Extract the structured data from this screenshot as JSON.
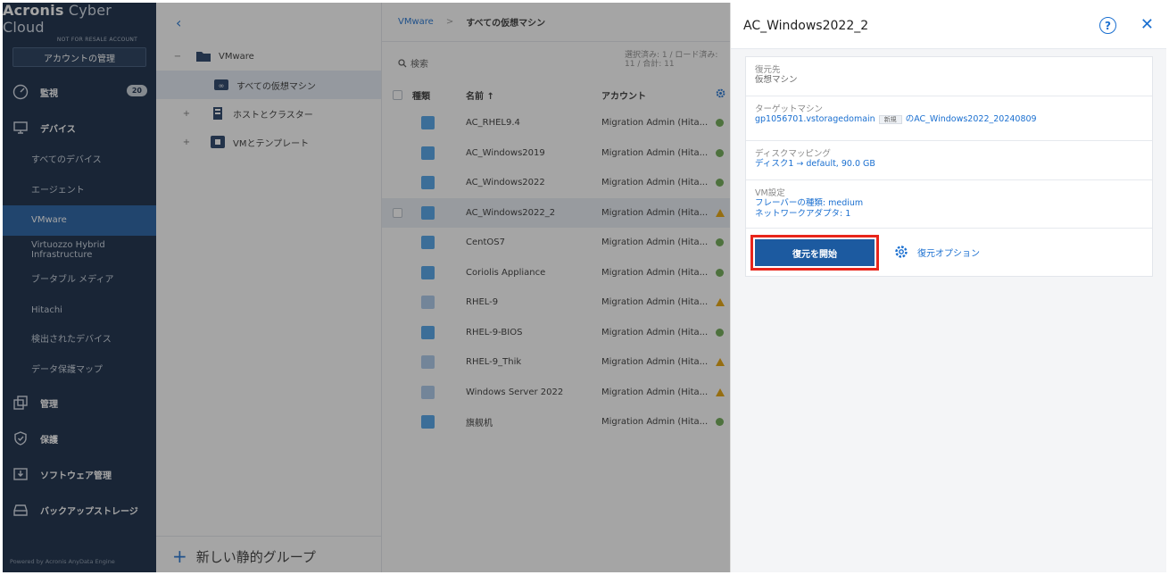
{
  "sidebar": {
    "brand_bold": "Acronis",
    "brand_light": " Cyber Cloud",
    "brand_tag": "NOT FOR RESALE ACCOUNT",
    "manage_button": "アカウントの管理",
    "monitor": "監視",
    "monitor_badge": "20",
    "devices": "デバイス",
    "sub_items": [
      "すべてのデバイス",
      "エージェント",
      "VMware",
      "Virtuozzo Hybrid Infrastructure",
      "ブータブル メディア",
      "Hitachi",
      "検出されたデバイス",
      "データ保護マップ"
    ],
    "admin": "管理",
    "protection": "保護",
    "software": "ソフトウェア管理",
    "backup_storage": "バックアップストレージ",
    "powered": "Powered by Acronis AnyData Engine"
  },
  "tree": {
    "back": "‹",
    "root": "VMware",
    "all_vms": "すべての仮想マシン",
    "hosts": "ホストとクラスター",
    "templates": "VMとテンプレート",
    "new_group": "新しい静的グループ"
  },
  "main": {
    "breadcrumb_1": "VMware",
    "breadcrumb_sep": ">",
    "breadcrumb_2": "すべての仮想マシン",
    "search": "検索",
    "selection_info": "選択済み: 1 / ロード済み: 11 / 合計: 11",
    "col_type": "種類",
    "col_name": "名前 ↑",
    "col_account": "アカウント",
    "rows": [
      {
        "name": "AC_RHEL9.4",
        "account": "Migration Admin (Hita...",
        "status": "ok",
        "on": true
      },
      {
        "name": "AC_Windows2019",
        "account": "Migration Admin (Hita...",
        "status": "ok",
        "on": true
      },
      {
        "name": "AC_Windows2022",
        "account": "Migration Admin (Hita...",
        "status": "ok",
        "on": true
      },
      {
        "name": "AC_Windows2022_2",
        "account": "Migration Admin (Hita...",
        "status": "warn",
        "on": true
      },
      {
        "name": "CentOS7",
        "account": "Migration Admin (Hita...",
        "status": "ok",
        "on": true
      },
      {
        "name": "Coriolis Appliance",
        "account": "Migration Admin (Hita...",
        "status": "ok",
        "on": true
      },
      {
        "name": "RHEL-9",
        "account": "Migration Admin (Hita...",
        "status": "warn",
        "on": false
      },
      {
        "name": "RHEL-9-BIOS",
        "account": "Migration Admin (Hita...",
        "status": "ok",
        "on": true
      },
      {
        "name": "RHEL-9_Thik",
        "account": "Migration Admin (Hita...",
        "status": "warn",
        "on": false
      },
      {
        "name": "Windows Server 2022",
        "account": "Migration Admin (Hita...",
        "status": "warn",
        "on": false
      },
      {
        "name": "旗舰机",
        "account": "Migration Admin (Hita...",
        "status": "ok",
        "on": true
      }
    ]
  },
  "panel": {
    "title": "AC_Windows2022_2",
    "help": "?",
    "close": "✕",
    "restore_to_label": "復元先",
    "restore_to_value": "仮想マシン",
    "target_label": "ターゲットマシン",
    "target_host": "gp1056701.vstoragedomain",
    "target_new": "新規",
    "target_name": "のAC_Windows2022_20240809",
    "disk_label": "ディスクマッピング",
    "disk_value": "ディスク1 → default, 90.0 GB",
    "vm_label": "VM設定",
    "vm_flavor": "フレーバーの種類: medium",
    "vm_network": "ネットワークアダプタ: 1",
    "start_button": "復元を開始",
    "options_link": "復元オプション"
  },
  "colors": {
    "sidebar_bg": "#0e2340",
    "accent": "#1a6fd0",
    "primary_button": "#1c5aa0",
    "highlight": "#e8251b",
    "ok": "#6aa84f",
    "warn": "#e5a100"
  }
}
